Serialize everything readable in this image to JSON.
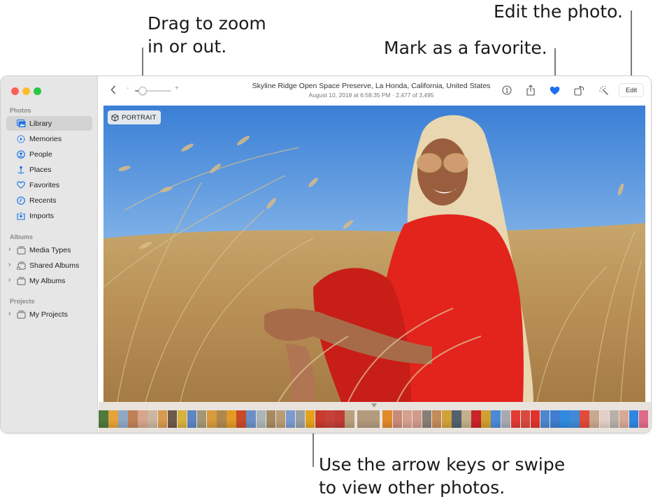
{
  "callouts": {
    "zoom": [
      "Drag to zoom",
      "in or out."
    ],
    "favorite": "Mark as a favorite.",
    "edit": "Edit the photo.",
    "navigate": [
      "Use the arrow keys or swipe",
      "to view other photos."
    ]
  },
  "window": {
    "traffic_lights": {
      "close": "#fe5f57",
      "minimize": "#febc2e",
      "zoom": "#28c840"
    }
  },
  "sidebar": {
    "sections": [
      {
        "title": "Photos",
        "items": [
          {
            "label": "Library",
            "icon": "library-icon",
            "active": true
          },
          {
            "label": "Memories",
            "icon": "memories-icon"
          },
          {
            "label": "People",
            "icon": "people-icon"
          },
          {
            "label": "Places",
            "icon": "places-icon"
          },
          {
            "label": "Favorites",
            "icon": "heart-icon"
          },
          {
            "label": "Recents",
            "icon": "clock-icon"
          },
          {
            "label": "Imports",
            "icon": "import-icon"
          }
        ]
      },
      {
        "title": "Albums",
        "items": [
          {
            "label": "Media Types",
            "icon": "folder-icon",
            "expandable": true
          },
          {
            "label": "Shared Albums",
            "icon": "shared-folder-icon",
            "expandable": true
          },
          {
            "label": "My Albums",
            "icon": "folder-icon",
            "expandable": true
          }
        ]
      },
      {
        "title": "Projects",
        "items": [
          {
            "label": "My Projects",
            "icon": "folder-icon",
            "expandable": true
          }
        ]
      }
    ]
  },
  "toolbar": {
    "back_icon": "‹",
    "zoom_minus": "-",
    "zoom_plus": "+",
    "zoom_level": 0.1,
    "title": "Skyline Ridge Open Space Preserve, La Honda, California, United States",
    "subtitle": "August 10, 2018 at 6:58:35 PM  ·  2,477 of 3,495",
    "favorite_color": "#1f6ff2",
    "edit_label": "Edit"
  },
  "photo": {
    "badge_label": "PORTRAIT"
  },
  "filmstrip": {
    "thumb_colors": [
      "#4f7a3c",
      "#e7a33a",
      "#8fa9c5",
      "#c08057",
      "#d8a48b",
      "#c9b5a0",
      "#d89a4c",
      "#6e5a4a",
      "#d9b23a",
      "#5d86c2",
      "#a39774",
      "#d99a3c",
      "#b0884f",
      "#e09a25",
      "#c94a2a",
      "#6b90c4",
      "#aab6b8",
      "#a58a62",
      "#b99b74",
      "#7a9bcf",
      "#9aa0a2",
      "#e4a21c",
      "#c83a2c",
      "#c4423a",
      "#c13a34",
      "#b9a07a"
    ],
    "current_thumb_color": "#b49a7c",
    "thumb_colors_after": [
      "#e08a28",
      "#c98a78",
      "#d6a08c",
      "#d09a8c",
      "#8a7e74",
      "#c48a5a",
      "#d1a23a",
      "#54606e",
      "#c2b08a",
      "#c8242a",
      "#d0a030",
      "#4a8ad6",
      "#a8aab0",
      "#e33a34",
      "#d94a40",
      "#e0332d",
      "#4c86cf",
      "#3f7ed0",
      "#2f8ae0",
      "#3f8ad8",
      "#e24a3a",
      "#c9a890",
      "#e2d0c6",
      "#b8b0a8",
      "#d8a894",
      "#2f86e0",
      "#e06a88"
    ]
  }
}
